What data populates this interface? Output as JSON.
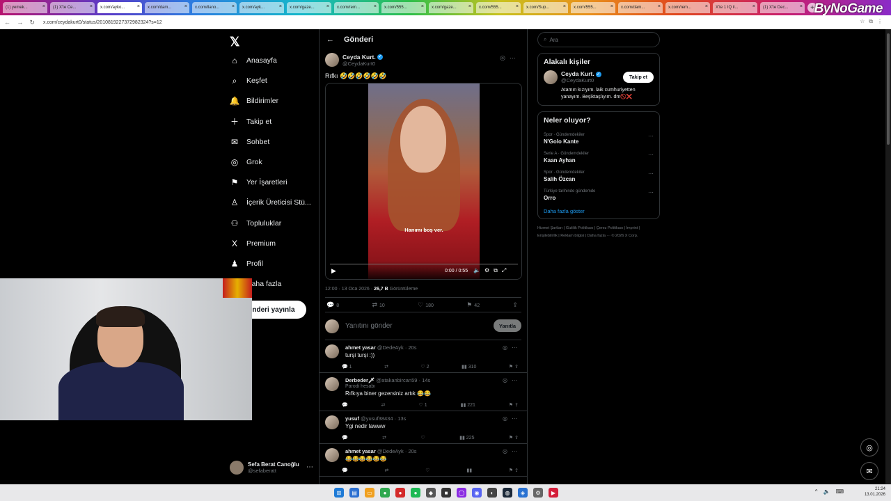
{
  "browser": {
    "tabs": [
      {
        "label": "(1) yemek...",
        "active": false
      },
      {
        "label": "(1) X'te Ce...",
        "active": false
      },
      {
        "label": "x.com/ayko...",
        "active": true
      },
      {
        "label": "x.com/dam...",
        "active": false
      },
      {
        "label": "x.com/ilano...",
        "active": false
      },
      {
        "label": "x.com/ayk...",
        "active": false
      },
      {
        "label": "x.com/gaze...",
        "active": false
      },
      {
        "label": "x.com/rem...",
        "active": false
      },
      {
        "label": "x.com/555...",
        "active": false
      },
      {
        "label": "x.com/gaze...",
        "active": false
      },
      {
        "label": "x.com/555...",
        "active": false
      },
      {
        "label": "x.com/Sup...",
        "active": false
      },
      {
        "label": "x.com/555...",
        "active": false
      },
      {
        "label": "x.com/dam...",
        "active": false
      },
      {
        "label": "x.com/rem...",
        "active": false
      },
      {
        "label": "X'te 1 IQ il...",
        "active": false
      },
      {
        "label": "(1) X'te Dec...",
        "active": false
      }
    ],
    "url": "x.com/ceydakurt0/status/2010819227372982324?s=12",
    "overlay_brand": "ByNoGame"
  },
  "nav": {
    "items": [
      {
        "label": "Anasayfa",
        "icon": "home-icon",
        "glyph": "⌂"
      },
      {
        "label": "Keşfet",
        "icon": "search-icon",
        "glyph": "⌕"
      },
      {
        "label": "Bildirimler",
        "icon": "bell-icon",
        "glyph": "🔔"
      },
      {
        "label": "Takip et",
        "icon": "follow-icon",
        "glyph": "＋"
      },
      {
        "label": "Sohbet",
        "icon": "mail-icon",
        "glyph": "✉"
      },
      {
        "label": "Grok",
        "icon": "grok-icon",
        "glyph": "◎"
      },
      {
        "label": "Yer İşaretleri",
        "icon": "bookmark-icon",
        "glyph": "⚑"
      },
      {
        "label": "İçerik Üreticisi Stü...",
        "icon": "creator-icon",
        "glyph": "♙"
      },
      {
        "label": "Topluluklar",
        "icon": "communities-icon",
        "glyph": "⚇"
      },
      {
        "label": "Premium",
        "icon": "x-premium-icon",
        "glyph": "X"
      },
      {
        "label": "Profil",
        "icon": "profile-icon",
        "glyph": "♟"
      },
      {
        "label": "Daha fazla",
        "icon": "more-icon",
        "glyph": "⋯"
      }
    ],
    "post_button": "Gönderi yayınla",
    "user": {
      "name": "Sefa Berat Canoğlu",
      "handle": "@sefaberatt"
    }
  },
  "post": {
    "header": "Gönderi",
    "author": {
      "name": "Ceyda Kurt.",
      "handle": "@CeydaKurt0"
    },
    "text": "Rıfkı 🤣🤣🤣🤣🤣🤣",
    "video": {
      "subtitle": "Hanımı boş ver.",
      "time": "0:00 / 0:55",
      "progress": 0
    },
    "meta": {
      "time": "12:00 · 13 Oca 2026",
      "views": "26,7 B",
      "views_label": "Görüntüleme"
    },
    "stats": {
      "replies": "8",
      "reposts": "10",
      "likes": "180",
      "bookmarks": "42"
    },
    "reply_placeholder": "Yanıtını gönder",
    "reply_button": "Yanıtla"
  },
  "comments": [
    {
      "name": "ahmet yasar",
      "handle": "@DedeAyk · 20s",
      "sub": "",
      "text": "turşi turşi :))",
      "replies": "1",
      "reposts": "",
      "likes": "2",
      "views": "310"
    },
    {
      "name": "Derbeder🗡",
      "handle": "@atakanbircan59 · 14s",
      "sub": "Parodi hesabı",
      "text": "Rıfkıya biner gezersiniz artık 😂😂",
      "replies": "",
      "reposts": "",
      "likes": "1",
      "views": "221"
    },
    {
      "name": "yusuf",
      "handle": "@yusuf38434 · 13s",
      "sub": "",
      "text": "Ygi nedir lawww",
      "replies": "",
      "reposts": "",
      "likes": "",
      "views": "225"
    },
    {
      "name": "ahmet yasar",
      "handle": "@DedeAyk · 20s",
      "sub": "",
      "text": "😂😂😂😂😂😂",
      "replies": "",
      "reposts": "",
      "likes": "",
      "views": ""
    }
  ],
  "sidebar": {
    "search_placeholder": "Ara",
    "relevant_title": "Alakalı kişiler",
    "relevant": {
      "name": "Ceyda Kurt.",
      "handle": "@CeydaKurt0",
      "bio": "Atamın kızıyım. laik cumhuriyetten yanayım. Beşiktaşlıyım. dm🚫❌",
      "follow": "Takip et"
    },
    "trends_title": "Neler oluyor?",
    "trends": [
      {
        "category": "Spor · Gündemdekiler",
        "title": "N'Golo Kante"
      },
      {
        "category": "Serie A · Gündemdekiler",
        "title": "Kaan Ayhan"
      },
      {
        "category": "Spor · Gündemdekiler",
        "title": "Salih Özcan"
      },
      {
        "category": "Türkiye tarihinde gündemde",
        "title": "Orro"
      }
    ],
    "show_more": "Daha fazla göster",
    "footer": "Hizmet Şartları  |  Gizlilik Politikası  |  Çerez Politikası  |  İmprint  |  Erişilebilirlik  |  Reklam bilgisi  |  Daha fazla ···  © 2026 X Corp."
  },
  "taskbar": {
    "time": "21:24",
    "date": "13.01.2026"
  }
}
